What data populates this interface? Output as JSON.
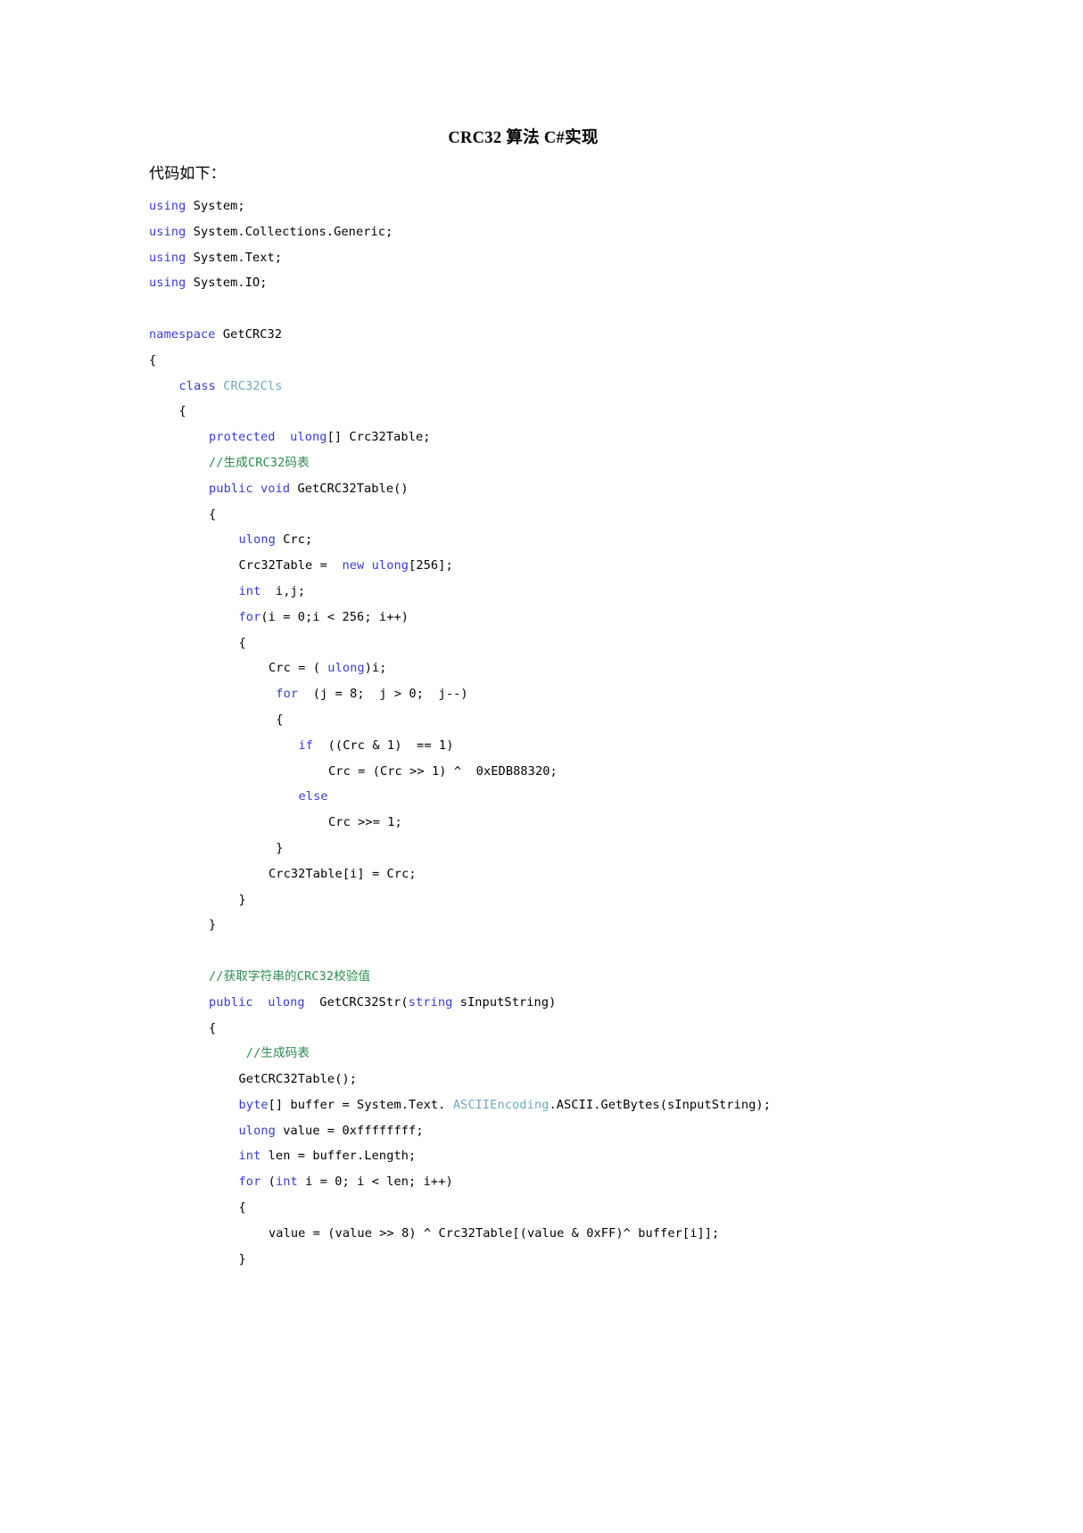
{
  "document": {
    "title": "CRC32 算法 C#实现",
    "intro": "代码如下："
  },
  "colors": {
    "keyword": "#3a3ad4",
    "type": "#6fa8c0",
    "comment": "#2e8b4f",
    "text": "#000000",
    "background": "#ffffff"
  },
  "code": {
    "language": "csharp",
    "lines": [
      {
        "indent": 0,
        "tokens": [
          {
            "t": "using",
            "c": "kw"
          },
          {
            "t": " System;",
            "c": "txt"
          }
        ]
      },
      {
        "indent": 0,
        "tokens": [
          {
            "t": "using",
            "c": "kw"
          },
          {
            "t": " System.Collections.Generic;",
            "c": "txt"
          }
        ]
      },
      {
        "indent": 0,
        "tokens": [
          {
            "t": "using",
            "c": "kw"
          },
          {
            "t": " System.Text;",
            "c": "txt"
          }
        ]
      },
      {
        "indent": 0,
        "tokens": [
          {
            "t": "using",
            "c": "kw"
          },
          {
            "t": " System.IO;",
            "c": "txt"
          }
        ]
      },
      {
        "indent": 0,
        "tokens": []
      },
      {
        "indent": 0,
        "tokens": [
          {
            "t": "namespace",
            "c": "kw"
          },
          {
            "t": " GetCRC32",
            "c": "txt"
          }
        ]
      },
      {
        "indent": 0,
        "tokens": [
          {
            "t": "{",
            "c": "txt"
          }
        ]
      },
      {
        "indent": 1,
        "tokens": [
          {
            "t": "class ",
            "c": "kw"
          },
          {
            "t": "CRC32Cls",
            "c": "type"
          }
        ]
      },
      {
        "indent": 1,
        "tokens": [
          {
            "t": "{",
            "c": "txt"
          }
        ]
      },
      {
        "indent": 2,
        "tokens": [
          {
            "t": "protected",
            "c": "kw"
          },
          {
            "t": "  ",
            "c": "txt"
          },
          {
            "t": "ulong",
            "c": "kw"
          },
          {
            "t": "[] Crc32Table;",
            "c": "txt"
          }
        ]
      },
      {
        "indent": 2,
        "tokens": [
          {
            "t": "//生成CRC32码表",
            "c": "cmt"
          }
        ]
      },
      {
        "indent": 2,
        "tokens": [
          {
            "t": "public",
            "c": "kw"
          },
          {
            "t": " ",
            "c": "txt"
          },
          {
            "t": "void",
            "c": "kw"
          },
          {
            "t": " GetCRC32Table()",
            "c": "txt"
          }
        ]
      },
      {
        "indent": 2,
        "tokens": [
          {
            "t": "{",
            "c": "txt"
          }
        ]
      },
      {
        "indent": 3,
        "tokens": [
          {
            "t": "ulong",
            "c": "kw"
          },
          {
            "t": " Crc;",
            "c": "txt"
          }
        ]
      },
      {
        "indent": 3,
        "tokens": [
          {
            "t": "Crc32Table =  ",
            "c": "txt"
          },
          {
            "t": "new",
            "c": "kw"
          },
          {
            "t": " ",
            "c": "txt"
          },
          {
            "t": "ulong",
            "c": "kw"
          },
          {
            "t": "[256];",
            "c": "txt"
          }
        ]
      },
      {
        "indent": 3,
        "tokens": [
          {
            "t": "int",
            "c": "kw"
          },
          {
            "t": "  i,j;",
            "c": "txt"
          }
        ]
      },
      {
        "indent": 3,
        "tokens": [
          {
            "t": "for",
            "c": "kw"
          },
          {
            "t": "(i = 0;i < 256; i++)",
            "c": "txt"
          }
        ]
      },
      {
        "indent": 3,
        "tokens": [
          {
            "t": "{",
            "c": "txt"
          }
        ]
      },
      {
        "indent": 4,
        "tokens": [
          {
            "t": "Crc = ( ",
            "c": "txt"
          },
          {
            "t": "ulong",
            "c": "kw"
          },
          {
            "t": ")i;",
            "c": "txt"
          }
        ]
      },
      {
        "indent": 4,
        "tokens": [
          {
            "t": " ",
            "c": "txt"
          },
          {
            "t": "for",
            "c": "kw"
          },
          {
            "t": "  (j = 8;  j > 0;  j--)",
            "c": "txt"
          }
        ]
      },
      {
        "indent": 4,
        "tokens": [
          {
            "t": " {",
            "c": "txt"
          }
        ]
      },
      {
        "indent": 5,
        "tokens": [
          {
            "t": "if",
            "c": "kw"
          },
          {
            "t": "  ((Crc & 1)  == 1)",
            "c": "txt"
          }
        ]
      },
      {
        "indent": 6,
        "tokens": [
          {
            "t": "Crc = (Crc >> 1) ^  0xEDB88320;",
            "c": "txt"
          }
        ]
      },
      {
        "indent": 5,
        "tokens": [
          {
            "t": "else",
            "c": "kw"
          }
        ]
      },
      {
        "indent": 6,
        "tokens": [
          {
            "t": "Crc >>= 1;",
            "c": "txt"
          }
        ]
      },
      {
        "indent": 4,
        "tokens": [
          {
            "t": " }",
            "c": "txt"
          }
        ]
      },
      {
        "indent": 4,
        "tokens": [
          {
            "t": "Crc32Table[i] = Crc;",
            "c": "txt"
          }
        ]
      },
      {
        "indent": 3,
        "tokens": [
          {
            "t": "}",
            "c": "txt"
          }
        ]
      },
      {
        "indent": 2,
        "tokens": [
          {
            "t": "}",
            "c": "txt"
          }
        ]
      },
      {
        "indent": 0,
        "tokens": []
      },
      {
        "indent": 2,
        "tokens": [
          {
            "t": "//获取字符串的CRC32校验值",
            "c": "cmt"
          }
        ]
      },
      {
        "indent": 2,
        "tokens": [
          {
            "t": "public",
            "c": "kw"
          },
          {
            "t": "  ",
            "c": "txt"
          },
          {
            "t": "ulong",
            "c": "kw"
          },
          {
            "t": "  GetCRC32Str(",
            "c": "txt"
          },
          {
            "t": "string",
            "c": "kw"
          },
          {
            "t": " sInputString)",
            "c": "txt"
          }
        ]
      },
      {
        "indent": 2,
        "tokens": [
          {
            "t": "{",
            "c": "txt"
          }
        ]
      },
      {
        "indent": 3,
        "tokens": [
          {
            "t": " //生成码表",
            "c": "cmt"
          }
        ]
      },
      {
        "indent": 3,
        "tokens": [
          {
            "t": "GetCRC32Table();",
            "c": "txt"
          }
        ]
      },
      {
        "indent": 3,
        "tokens": [
          {
            "t": "byte",
            "c": "kw"
          },
          {
            "t": "[] buffer = System.Text. ",
            "c": "txt"
          },
          {
            "t": "ASCIIEncoding",
            "c": "type"
          },
          {
            "t": ".ASCII.GetBytes(sInputString);",
            "c": "txt"
          }
        ]
      },
      {
        "indent": 3,
        "tokens": [
          {
            "t": "ulong",
            "c": "kw"
          },
          {
            "t": " value = 0xffffffff;",
            "c": "txt"
          }
        ]
      },
      {
        "indent": 3,
        "tokens": [
          {
            "t": "int",
            "c": "kw"
          },
          {
            "t": " len = buffer.Length;",
            "c": "txt"
          }
        ]
      },
      {
        "indent": 3,
        "tokens": [
          {
            "t": "for",
            "c": "kw"
          },
          {
            "t": " (",
            "c": "txt"
          },
          {
            "t": "int",
            "c": "kw"
          },
          {
            "t": " i = 0; i < len; i++)",
            "c": "txt"
          }
        ]
      },
      {
        "indent": 3,
        "tokens": [
          {
            "t": "{",
            "c": "txt"
          }
        ]
      },
      {
        "indent": 4,
        "tokens": [
          {
            "t": "value = (value >> 8) ^ Crc32Table[(value & 0xFF)^ buffer[i]];",
            "c": "txt"
          }
        ]
      },
      {
        "indent": 3,
        "tokens": [
          {
            "t": "}",
            "c": "txt"
          }
        ]
      }
    ]
  }
}
